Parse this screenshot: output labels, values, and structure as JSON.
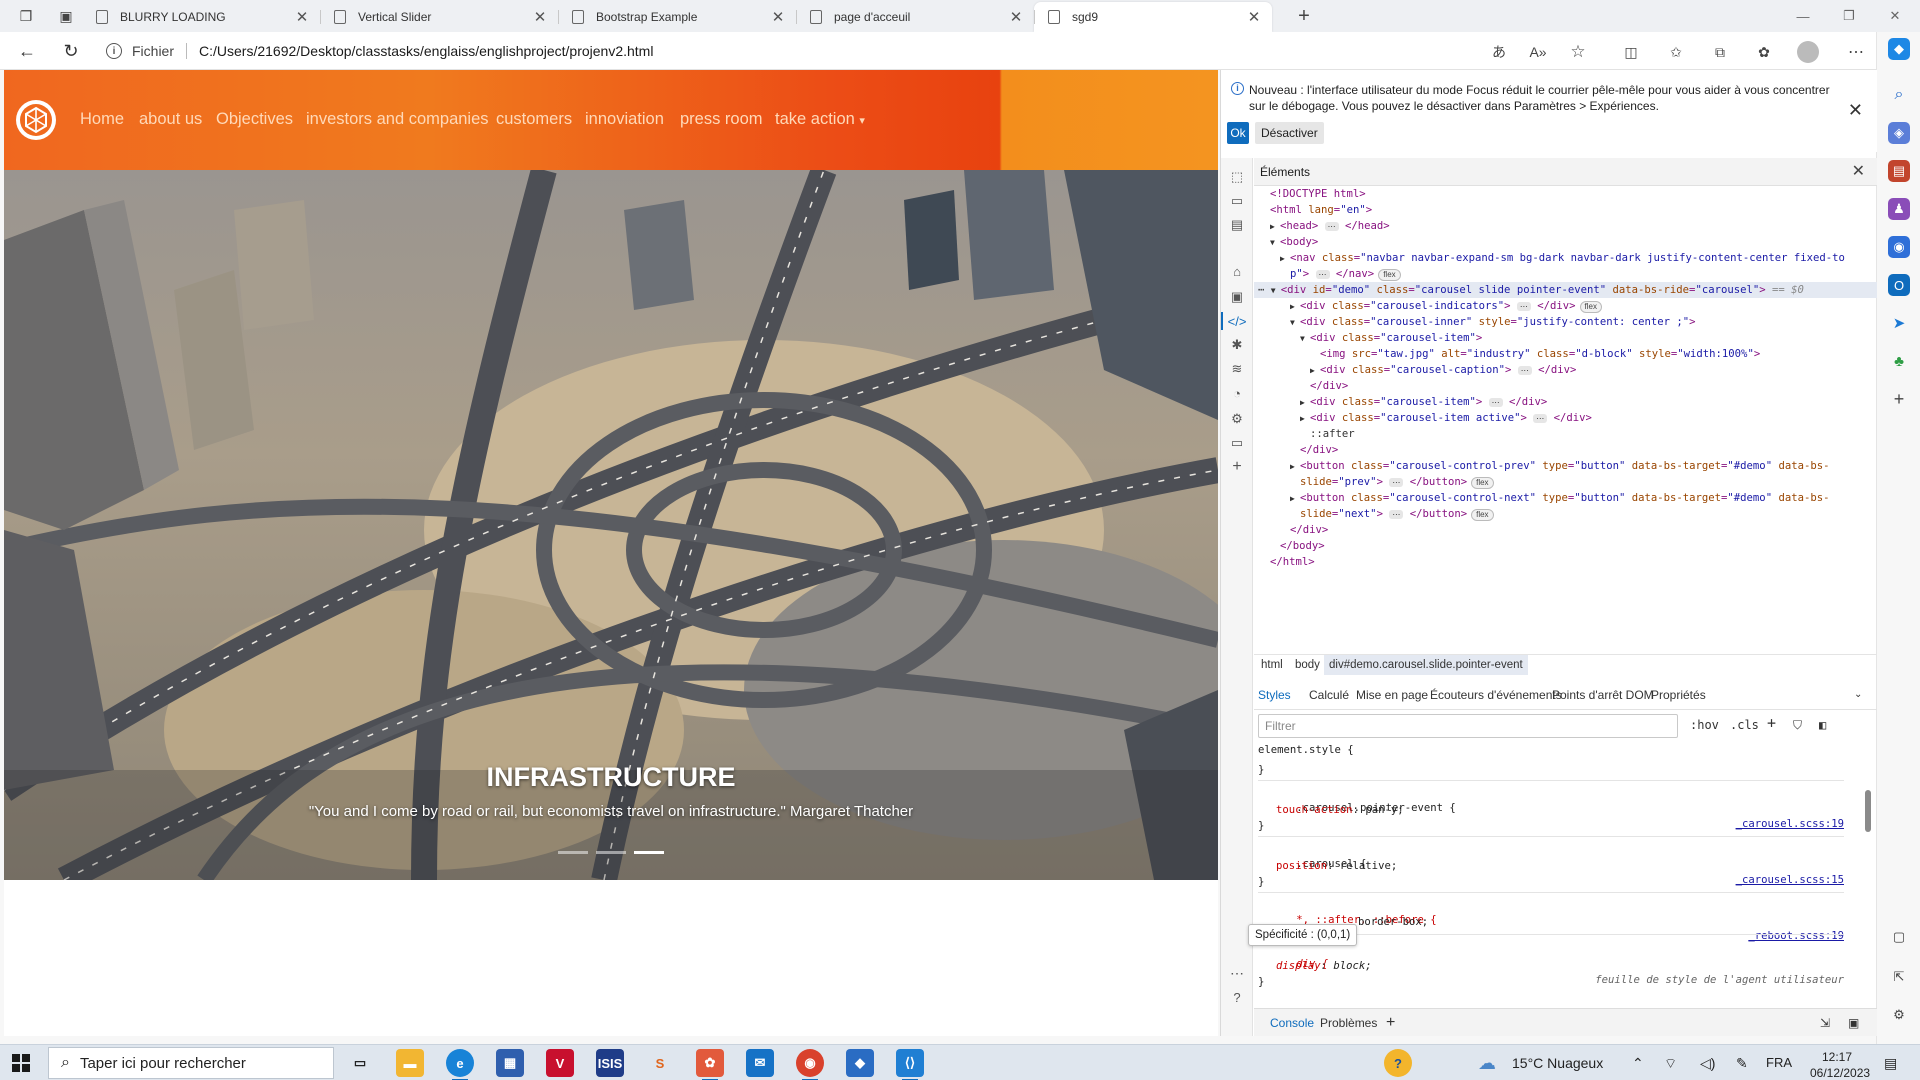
{
  "browser": {
    "tabs": [
      {
        "title": "BLURRY LOADING"
      },
      {
        "title": "Vertical Slider"
      },
      {
        "title": "Bootstrap Example"
      },
      {
        "title": "page d'acceuil"
      },
      {
        "title": "sgd9"
      }
    ],
    "url_scheme": "Fichier",
    "url": "C:/Users/21692/Desktop/classtasks/englaiss/englishproject/projenv2.html"
  },
  "site": {
    "nav": [
      "Home",
      "about us",
      "Objectives",
      "investors and companies",
      "customers",
      "innoviation",
      "press room",
      "take action"
    ],
    "dropdown_caret": "▾",
    "slide": {
      "title": "INFRASTRUCTURE",
      "quote": "\"You and I come by road or rail, but economists travel on infrastructure.\" Margaret Thatcher",
      "indicators": 3,
      "active_indicator": 3
    }
  },
  "devtools": {
    "notice": "Nouveau : l'interface utilisateur du mode Focus réduit le courrier pêle-mêle pour vous aider à vous concentrer sur le débogage. Vous pouvez le désactiver dans Paramètres > Expériences.",
    "ok": "Ok",
    "deactivate": "Désactiver",
    "panel_title": "Éléments",
    "breadcrumbs": [
      "html",
      "body",
      "div#demo.carousel.slide.pointer-event"
    ],
    "style_tabs": [
      "Styles",
      "Calculé",
      "Mise en page",
      "Écouteurs d'événements",
      "Points d'arrêt DOM",
      "Propriétés"
    ],
    "filter_placeholder": "Filtrer",
    "hov": ":hov",
    "cls": ".cls",
    "rules": {
      "element_style": "element.style {",
      "r1_sel": ".carousel.pointer-event {",
      "r1_prop": "touch-action",
      "r1_val": "pan-y;",
      "r1_src": "_carousel.scss:19",
      "r2_sel": ".carousel {",
      "r2_prop": "position",
      "r2_val": "relative;",
      "r2_src": "_carousel.scss:15",
      "r3_sel": "*, ::after, ::before {",
      "r3_val": "border-box;",
      "r3_src": "_reboot.scss:19",
      "r4_sel": "div {",
      "r4_prop": "display",
      "r4_val": "block;",
      "r4_src": "feuille de style de l'agent utilisateur",
      "close": "}"
    },
    "tooltip": "Spécificité : (0,0,1)",
    "drawer_tabs": [
      "Console",
      "Problèmes"
    ]
  },
  "taskbar": {
    "search_placeholder": "Taper ici pour rechercher",
    "weather": "15°C Nuageux",
    "lang": "FRA",
    "time": "12:17",
    "date": "06/12/2023"
  },
  "colors": {
    "nav_orange": "#f07a1e",
    "nav_red": "#e8420f",
    "devtools_blue": "#0f6cbd"
  }
}
